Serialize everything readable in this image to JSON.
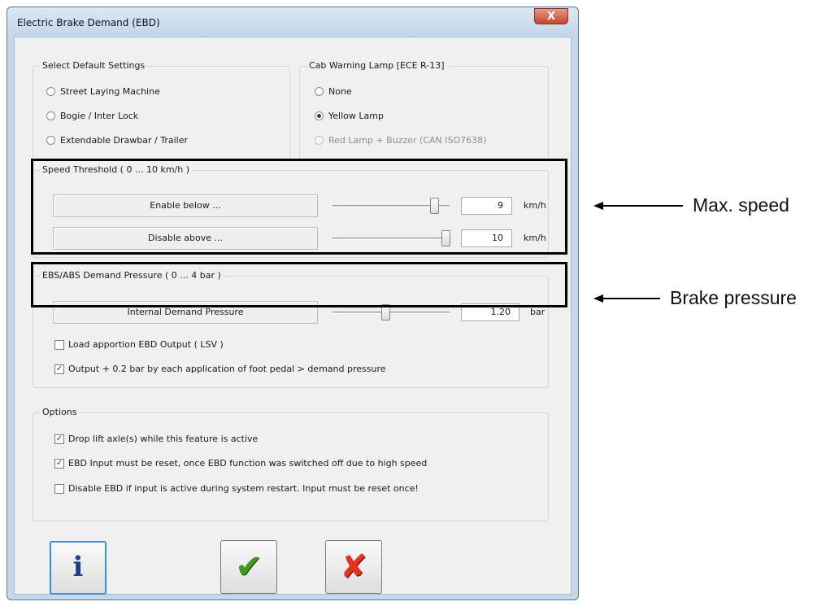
{
  "window": {
    "title": "Electric Brake Demand (EBD)",
    "close_glyph": "X"
  },
  "defaults": {
    "title": "Select Default Settings",
    "options": [
      {
        "label": "Street Laying Machine",
        "selected": false
      },
      {
        "label": "Bogie / Inter Lock",
        "selected": false
      },
      {
        "label": "Extendable Drawbar / Trailer",
        "selected": false
      }
    ]
  },
  "lamp": {
    "title": "Cab Warning Lamp [ECE R-13]",
    "options": [
      {
        "label": "None",
        "selected": false,
        "enabled": true
      },
      {
        "label": "Yellow Lamp",
        "selected": true,
        "enabled": true
      },
      {
        "label": "Red Lamp + Buzzer (CAN ISO7638)",
        "selected": false,
        "enabled": false
      }
    ]
  },
  "speed": {
    "title": "Speed Threshold ( 0 ... 10 km/h )",
    "range": [
      0,
      10
    ],
    "rows": [
      {
        "label": "Enable below ...",
        "value": "9",
        "unit": "km/h"
      },
      {
        "label": "Disable above ...",
        "value": "10",
        "unit": "km/h"
      }
    ]
  },
  "pressure": {
    "title": "EBS/ABS Demand Pressure ( 0 ... 4 bar )",
    "range": [
      0,
      4
    ],
    "row": {
      "label": "Internal Demand Pressure",
      "value": "1.20",
      "unit": "bar"
    },
    "checks": [
      {
        "label": "Load apportion EBD Output ( LSV )",
        "checked": false
      },
      {
        "label": "Output + 0.2 bar by each application of foot pedal > demand pressure",
        "checked": true
      }
    ]
  },
  "options": {
    "title": "Options",
    "checks": [
      {
        "label": "Drop lift axle(s) while this feature is active",
        "checked": true
      },
      {
        "label": "EBD Input must be reset, once EBD function was switched off due to high speed",
        "checked": true
      },
      {
        "label": "Disable EBD if input is active during system restart. Input must be reset once!",
        "checked": false
      }
    ]
  },
  "buttons": {
    "info_glyph": "i",
    "ok_glyph": "✔",
    "cancel_glyph": "✘"
  },
  "annotations": {
    "max_speed": "Max. speed",
    "brake_pressure": "Brake pressure"
  },
  "colors": {
    "ok": "#3f9a1f",
    "cancel": "#e2351e",
    "info": "#1f3f8c"
  }
}
